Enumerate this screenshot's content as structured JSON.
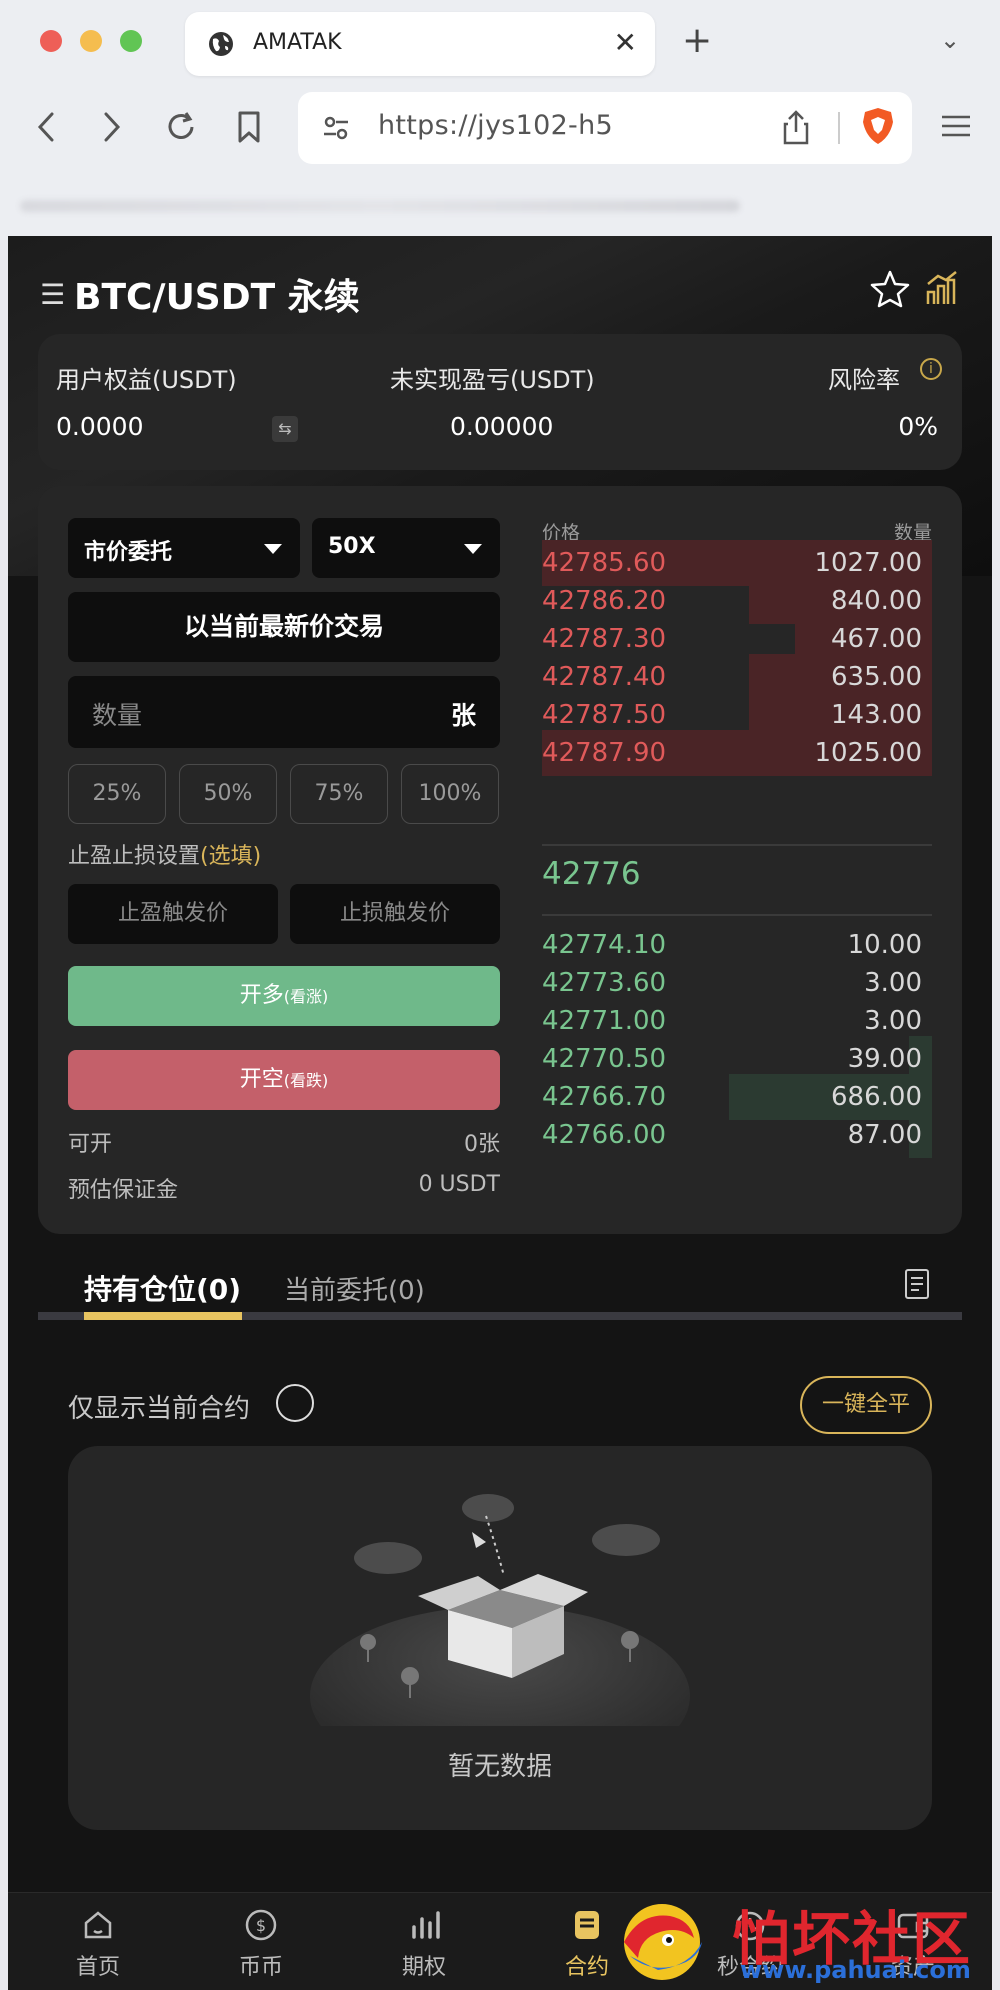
{
  "browser": {
    "tab_title": "AMATAK",
    "url": "https://jys102-h5"
  },
  "header": {
    "pair": "BTC/USDT 永续"
  },
  "account": {
    "equity_label": "用户权益(USDT)",
    "equity_value": "0.0000",
    "unrealized_label": "未实现盈亏(USDT)",
    "unrealized_value": "0.00000",
    "risk_label": "风险率",
    "risk_value": "0%"
  },
  "order_form": {
    "order_type": "市价委托",
    "leverage": "50X",
    "latest_price_button": "以当前最新价交易",
    "quantity_placeholder": "数量",
    "quantity_unit": "张",
    "percents": [
      "25%",
      "50%",
      "75%",
      "100%"
    ],
    "tpsl_label": "止盈止损设置",
    "tpsl_optional": "(选填)",
    "tp_placeholder": "止盈触发价",
    "sl_placeholder": "止损触发价",
    "long_label": "开多",
    "long_sub": "(看涨)",
    "short_label": "开空",
    "short_sub": "(看跌)",
    "available_label": "可开",
    "available_value": "0张",
    "margin_label": "预估保证金",
    "margin_value": "0 USDT"
  },
  "orderbook": {
    "price_header": "价格",
    "qty_header": "数量",
    "asks": [
      {
        "price": "42785.60",
        "qty": "1027.00",
        "depth": 1.0
      },
      {
        "price": "42786.20",
        "qty": "840.00",
        "depth": 0.47
      },
      {
        "price": "42787.30",
        "qty": "467.00",
        "depth": 0.35
      },
      {
        "price": "42787.40",
        "qty": "635.00",
        "depth": 0.47
      },
      {
        "price": "42787.50",
        "qty": "143.00",
        "depth": 0.47
      },
      {
        "price": "42787.90",
        "qty": "1025.00",
        "depth": 1.0
      }
    ],
    "last_price": "42776",
    "bids": [
      {
        "price": "42774.10",
        "qty": "10.00",
        "depth": 0.0
      },
      {
        "price": "42773.60",
        "qty": "3.00",
        "depth": 0.0
      },
      {
        "price": "42771.00",
        "qty": "3.00",
        "depth": 0.0
      },
      {
        "price": "42770.50",
        "qty": "39.00",
        "depth": 0.06
      },
      {
        "price": "42766.70",
        "qty": "686.00",
        "depth": 0.52
      },
      {
        "price": "42766.00",
        "qty": "87.00",
        "depth": 0.06
      }
    ]
  },
  "positions": {
    "tab_holdings": "持有仓位(0)",
    "tab_orders": "当前委托(0)",
    "only_current_label": "仅显示当前合约",
    "close_all_button": "一键全平",
    "empty_text": "暂无数据"
  },
  "bottom_nav": [
    {
      "label": "首页",
      "icon": "home-icon"
    },
    {
      "label": "币币",
      "icon": "coin-icon"
    },
    {
      "label": "期权",
      "icon": "bar-chart-icon"
    },
    {
      "label": "合约",
      "icon": "contract-icon",
      "active": true
    },
    {
      "label": "秒合约",
      "icon": "timer-icon"
    },
    {
      "label": "资产",
      "icon": "wallet-icon"
    }
  ],
  "watermark": {
    "text": "怕坏社区",
    "url": "www.pahuai.com"
  },
  "colors": {
    "accent": "#e8c460",
    "buy": "#79c58f",
    "sell": "#e05a5a",
    "long_button": "#6fb98a",
    "short_button": "#c4606a"
  }
}
